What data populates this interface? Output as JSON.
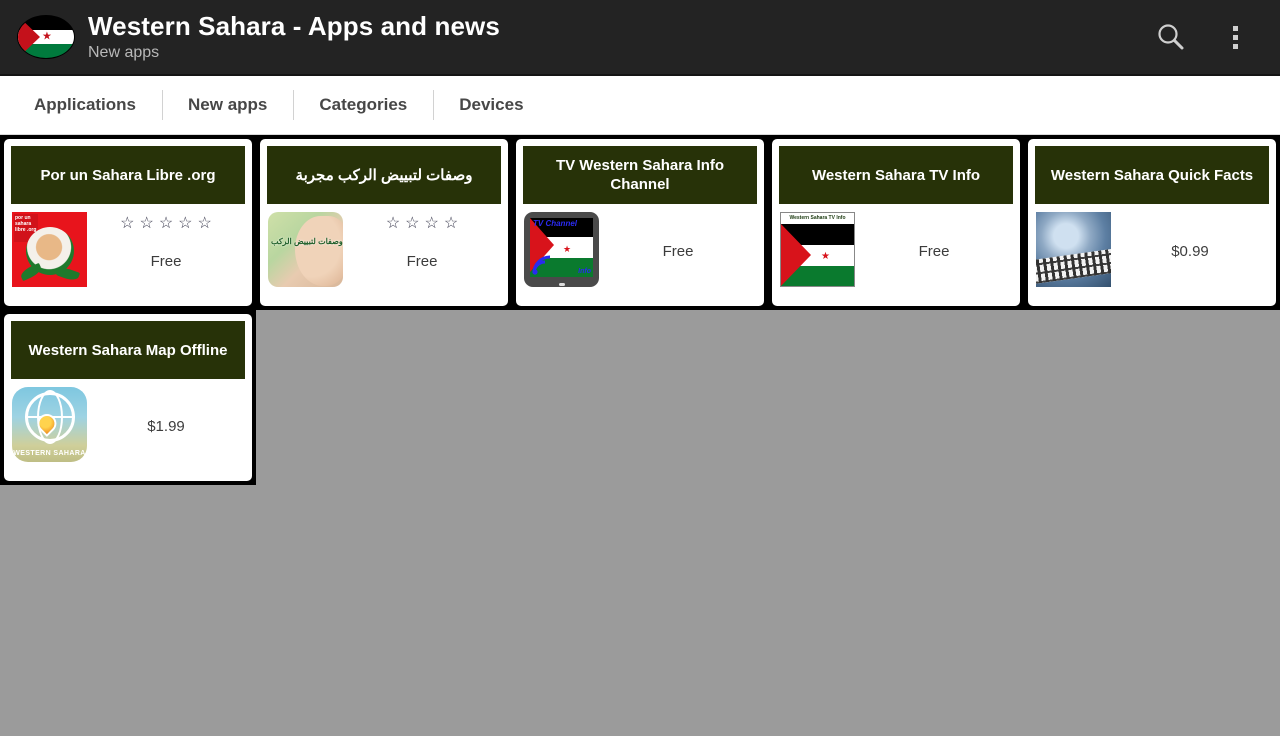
{
  "appbar": {
    "icon_name": "western-sahara-flag-icon",
    "title": "Western Sahara - Apps and news",
    "subtitle": "New apps",
    "search_icon": "search-icon",
    "overflow_icon": "overflow-menu-icon"
  },
  "tabs": [
    {
      "label": "Applications"
    },
    {
      "label": "New apps"
    },
    {
      "label": "Categories"
    },
    {
      "label": "Devices"
    }
  ],
  "cards": [
    {
      "title": "Por un Sahara Libre .org",
      "stars": 5,
      "price": "Free",
      "thumb": "fist-rose-thumbnail",
      "thumb_label": "por un sahara libre .org"
    },
    {
      "title": "وصفات لتبييض الركب مجربة",
      "stars": 4,
      "price": "Free",
      "thumb": "knee-whitening-thumbnail",
      "thumb_label": "وصفات لتبييض الركب"
    },
    {
      "title": "TV Western Sahara Info Channel",
      "stars": 0,
      "price": "Free",
      "thumb": "tv-channel-thumbnail",
      "thumb_label": "TV Channel",
      "thumb_label2": "Info"
    },
    {
      "title": "Western Sahara TV Info",
      "stars": 0,
      "price": "Free",
      "thumb": "flag-thumbnail",
      "thumb_label": "Western Sahara TV Info"
    },
    {
      "title": "Western Sahara Quick Facts",
      "stars": 0,
      "price": "$0.99",
      "thumb": "globe-quick-facts-thumbnail"
    },
    {
      "title": "Western Sahara Map Offline",
      "stars": 0,
      "price": "$1.99",
      "thumb": "globe-pin-map-thumbnail",
      "thumb_label": "WESTERN SAHARA"
    }
  ],
  "colors": {
    "appbar_bg": "#232323",
    "page_bg": "#9b9b9b",
    "card_header_green": "#273208",
    "card_border": "#000000"
  },
  "star_glyph": "☆"
}
